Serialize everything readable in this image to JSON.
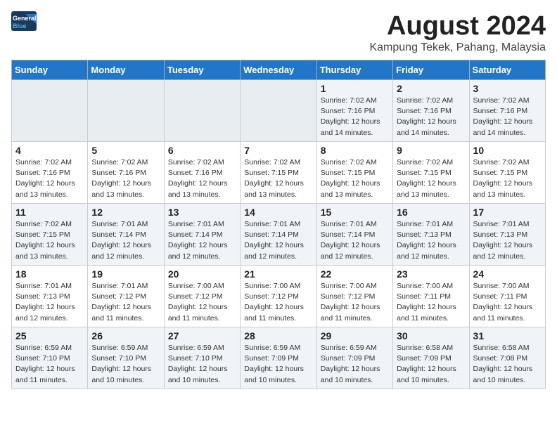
{
  "header": {
    "logo_general": "General",
    "logo_blue": "Blue",
    "month_title": "August 2024",
    "location": "Kampung Tekek, Pahang, Malaysia"
  },
  "days_of_week": [
    "Sunday",
    "Monday",
    "Tuesday",
    "Wednesday",
    "Thursday",
    "Friday",
    "Saturday"
  ],
  "weeks": [
    [
      {
        "day": "",
        "info": ""
      },
      {
        "day": "",
        "info": ""
      },
      {
        "day": "",
        "info": ""
      },
      {
        "day": "",
        "info": ""
      },
      {
        "day": "1",
        "info": "Sunrise: 7:02 AM\nSunset: 7:16 PM\nDaylight: 12 hours\nand 14 minutes."
      },
      {
        "day": "2",
        "info": "Sunrise: 7:02 AM\nSunset: 7:16 PM\nDaylight: 12 hours\nand 14 minutes."
      },
      {
        "day": "3",
        "info": "Sunrise: 7:02 AM\nSunset: 7:16 PM\nDaylight: 12 hours\nand 14 minutes."
      }
    ],
    [
      {
        "day": "4",
        "info": "Sunrise: 7:02 AM\nSunset: 7:16 PM\nDaylight: 12 hours\nand 13 minutes."
      },
      {
        "day": "5",
        "info": "Sunrise: 7:02 AM\nSunset: 7:16 PM\nDaylight: 12 hours\nand 13 minutes."
      },
      {
        "day": "6",
        "info": "Sunrise: 7:02 AM\nSunset: 7:16 PM\nDaylight: 12 hours\nand 13 minutes."
      },
      {
        "day": "7",
        "info": "Sunrise: 7:02 AM\nSunset: 7:15 PM\nDaylight: 12 hours\nand 13 minutes."
      },
      {
        "day": "8",
        "info": "Sunrise: 7:02 AM\nSunset: 7:15 PM\nDaylight: 12 hours\nand 13 minutes."
      },
      {
        "day": "9",
        "info": "Sunrise: 7:02 AM\nSunset: 7:15 PM\nDaylight: 12 hours\nand 13 minutes."
      },
      {
        "day": "10",
        "info": "Sunrise: 7:02 AM\nSunset: 7:15 PM\nDaylight: 12 hours\nand 13 minutes."
      }
    ],
    [
      {
        "day": "11",
        "info": "Sunrise: 7:02 AM\nSunset: 7:15 PM\nDaylight: 12 hours\nand 13 minutes."
      },
      {
        "day": "12",
        "info": "Sunrise: 7:01 AM\nSunset: 7:14 PM\nDaylight: 12 hours\nand 12 minutes."
      },
      {
        "day": "13",
        "info": "Sunrise: 7:01 AM\nSunset: 7:14 PM\nDaylight: 12 hours\nand 12 minutes."
      },
      {
        "day": "14",
        "info": "Sunrise: 7:01 AM\nSunset: 7:14 PM\nDaylight: 12 hours\nand 12 minutes."
      },
      {
        "day": "15",
        "info": "Sunrise: 7:01 AM\nSunset: 7:14 PM\nDaylight: 12 hours\nand 12 minutes."
      },
      {
        "day": "16",
        "info": "Sunrise: 7:01 AM\nSunset: 7:13 PM\nDaylight: 12 hours\nand 12 minutes."
      },
      {
        "day": "17",
        "info": "Sunrise: 7:01 AM\nSunset: 7:13 PM\nDaylight: 12 hours\nand 12 minutes."
      }
    ],
    [
      {
        "day": "18",
        "info": "Sunrise: 7:01 AM\nSunset: 7:13 PM\nDaylight: 12 hours\nand 12 minutes."
      },
      {
        "day": "19",
        "info": "Sunrise: 7:01 AM\nSunset: 7:12 PM\nDaylight: 12 hours\nand 11 minutes."
      },
      {
        "day": "20",
        "info": "Sunrise: 7:00 AM\nSunset: 7:12 PM\nDaylight: 12 hours\nand 11 minutes."
      },
      {
        "day": "21",
        "info": "Sunrise: 7:00 AM\nSunset: 7:12 PM\nDaylight: 12 hours\nand 11 minutes."
      },
      {
        "day": "22",
        "info": "Sunrise: 7:00 AM\nSunset: 7:12 PM\nDaylight: 12 hours\nand 11 minutes."
      },
      {
        "day": "23",
        "info": "Sunrise: 7:00 AM\nSunset: 7:11 PM\nDaylight: 12 hours\nand 11 minutes."
      },
      {
        "day": "24",
        "info": "Sunrise: 7:00 AM\nSunset: 7:11 PM\nDaylight: 12 hours\nand 11 minutes."
      }
    ],
    [
      {
        "day": "25",
        "info": "Sunrise: 6:59 AM\nSunset: 7:10 PM\nDaylight: 12 hours\nand 11 minutes."
      },
      {
        "day": "26",
        "info": "Sunrise: 6:59 AM\nSunset: 7:10 PM\nDaylight: 12 hours\nand 10 minutes."
      },
      {
        "day": "27",
        "info": "Sunrise: 6:59 AM\nSunset: 7:10 PM\nDaylight: 12 hours\nand 10 minutes."
      },
      {
        "day": "28",
        "info": "Sunrise: 6:59 AM\nSunset: 7:09 PM\nDaylight: 12 hours\nand 10 minutes."
      },
      {
        "day": "29",
        "info": "Sunrise: 6:59 AM\nSunset: 7:09 PM\nDaylight: 12 hours\nand 10 minutes."
      },
      {
        "day": "30",
        "info": "Sunrise: 6:58 AM\nSunset: 7:09 PM\nDaylight: 12 hours\nand 10 minutes."
      },
      {
        "day": "31",
        "info": "Sunrise: 6:58 AM\nSunset: 7:08 PM\nDaylight: 12 hours\nand 10 minutes."
      }
    ]
  ]
}
